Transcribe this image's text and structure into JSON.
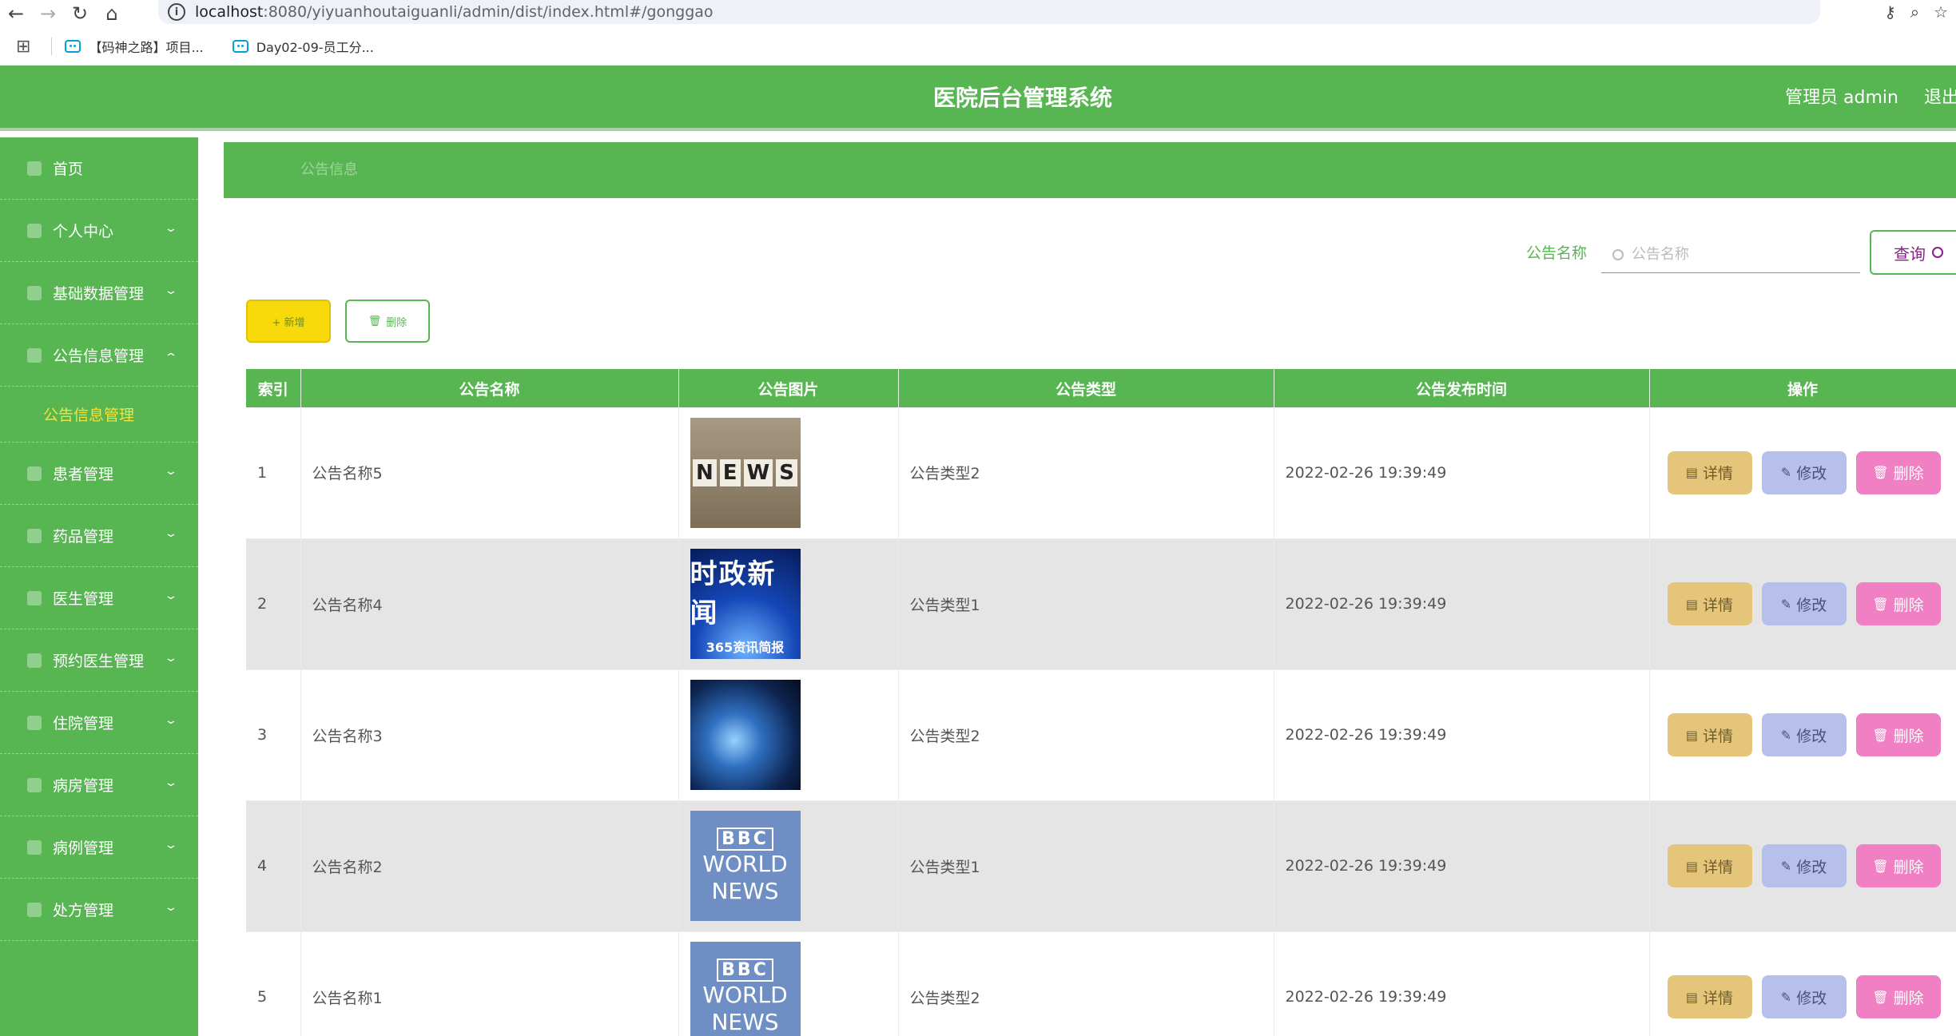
{
  "browser": {
    "url_host": "localhost",
    "url_path": ":8080/yiyuanhoutaiguanli/admin/dist/index.html#/gonggao",
    "bookmarks": [
      "【码神之路】项目...",
      "Day02-09-员工分..."
    ]
  },
  "header": {
    "title": "医院后台管理系统",
    "user": "管理员 admin",
    "logout": "退出"
  },
  "sidebar": {
    "items": [
      {
        "label": "首页"
      },
      {
        "label": "个人中心"
      },
      {
        "label": "基础数据管理"
      },
      {
        "label": "公告信息管理"
      },
      {
        "label": "公告信息管理"
      },
      {
        "label": "患者管理"
      },
      {
        "label": "药品管理"
      },
      {
        "label": "医生管理"
      },
      {
        "label": "预约医生管理"
      },
      {
        "label": "住院管理"
      },
      {
        "label": "病房管理"
      },
      {
        "label": "病例管理"
      },
      {
        "label": "处方管理"
      }
    ]
  },
  "breadcrumb": "公告信息",
  "search": {
    "label": "公告名称",
    "placeholder": "公告名称",
    "button": "查询"
  },
  "toolbar": {
    "add": "+ 新增",
    "delete": "删除"
  },
  "table": {
    "columns": [
      "索引",
      "公告名称",
      "公告图片",
      "公告类型",
      "公告发布时间",
      "操作"
    ],
    "rows": [
      {
        "index": "1",
        "name": "公告名称5",
        "type": "公告类型2",
        "time": "2022-02-26 19:39:49"
      },
      {
        "index": "2",
        "name": "公告名称4",
        "type": "公告类型1",
        "time": "2022-02-26 19:39:49"
      },
      {
        "index": "3",
        "name": "公告名称3",
        "type": "公告类型2",
        "time": "2022-02-26 19:39:49"
      },
      {
        "index": "4",
        "name": "公告名称2",
        "type": "公告类型1",
        "time": "2022-02-26 19:39:49"
      },
      {
        "index": "5",
        "name": "公告名称1",
        "type": "公告类型2",
        "time": "2022-02-26 19:39:49"
      }
    ],
    "images": {
      "news": [
        "N",
        "E",
        "W",
        "S"
      ],
      "shizheng_title": "时政新闻",
      "shizheng_sub": "365资讯简报",
      "bbc_brand": "BBC",
      "bbc_line1": "WORLD",
      "bbc_line2": "NEWS"
    },
    "actions": {
      "detail": "详情",
      "edit": "修改",
      "delete": "删除"
    }
  },
  "colors": {
    "primary": "#57b552",
    "accent_yellow": "#f7d90c",
    "detail": "#e5c57a",
    "edit": "#b7c0ea",
    "delete": "#f07fc4"
  }
}
